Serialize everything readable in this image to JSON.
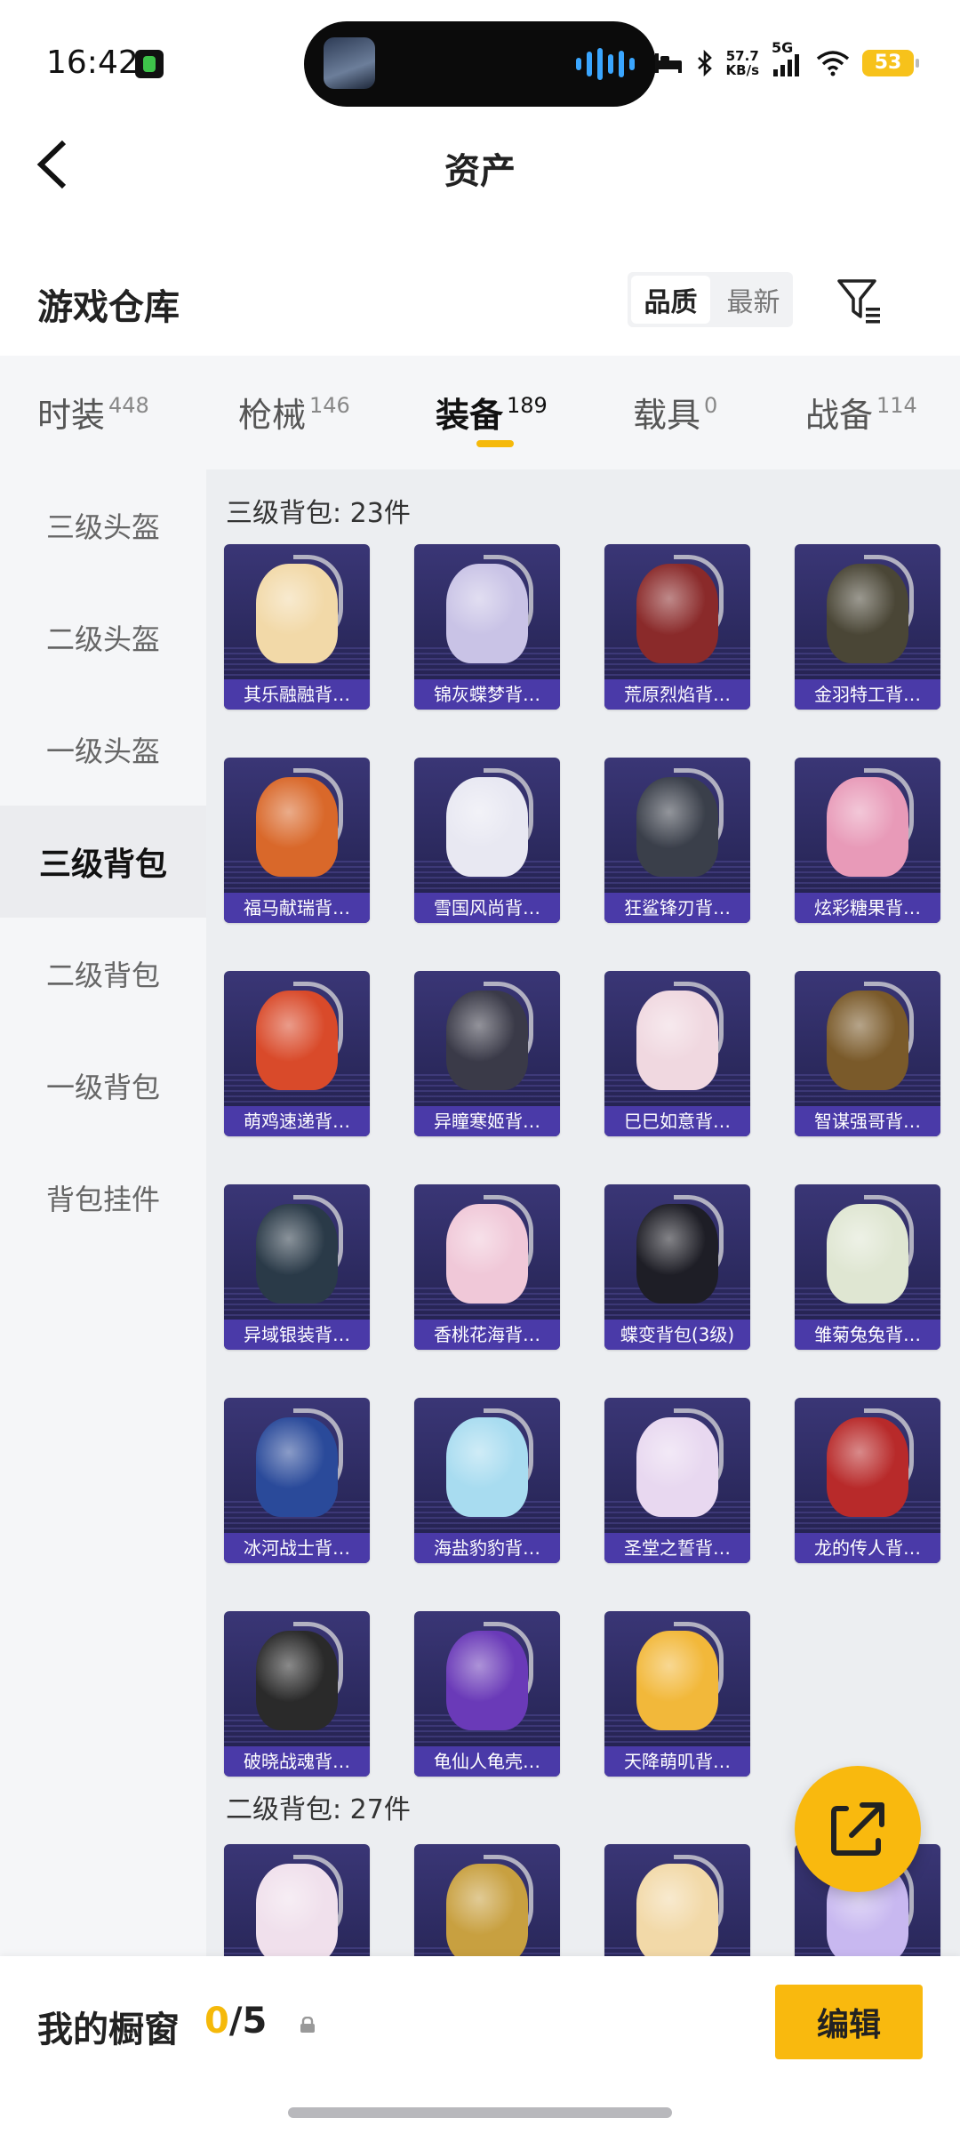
{
  "status_bar": {
    "time": "16:42",
    "speed_value": "57.7",
    "speed_unit": "KB/s",
    "network": "5G",
    "battery": "53",
    "icons": [
      "app-notification-icon",
      "bed-icon",
      "bluetooth-icon",
      "signal-icon",
      "wifi-icon",
      "battery-icon"
    ]
  },
  "header": {
    "title": "资产",
    "back_icon": "chevron-left-icon"
  },
  "warehouse": {
    "title": "游戏仓库",
    "sort_options": [
      "品质",
      "最新"
    ],
    "sort_active": "品质",
    "filter_icon": "filter-icon"
  },
  "tabs": [
    {
      "label": "时装",
      "count": "448"
    },
    {
      "label": "枪械",
      "count": "146"
    },
    {
      "label": "装备",
      "count": "189",
      "active": true
    },
    {
      "label": "载具",
      "count": "0"
    },
    {
      "label": "战备",
      "count": "114"
    }
  ],
  "side_menu": {
    "items": [
      "三级头盔",
      "二级头盔",
      "一级头盔",
      "三级背包",
      "二级背包",
      "一级背包",
      "背包挂件"
    ],
    "active": "三级背包"
  },
  "sections": [
    {
      "title": "三级背包: 23件",
      "items": [
        "其乐融融背…",
        "锦灰蝶梦背…",
        "荒原烈焰背…",
        "金羽特工背…",
        "福马献瑞背…",
        "雪国风尚背…",
        "狂鲨锋刃背…",
        "炫彩糖果背…",
        "萌鸡速递背…",
        "异瞳寒姬背…",
        "巳巳如意背…",
        "智谋强哥背…",
        "异域银装背…",
        "香桃花海背…",
        "蝶变背包(3级)",
        "雏菊兔兔背…",
        "冰河战士背…",
        "海盐豹豹背…",
        "圣堂之誓背…",
        "龙的传人背…",
        "破晓战魂背…",
        "龟仙人龟壳…",
        "天降萌叽背…"
      ]
    },
    {
      "title": "二级背包: 27件",
      "items": [
        "",
        "",
        "",
        ""
      ]
    }
  ],
  "item_colors": [
    "#f2d9a8",
    "#c9c3e6",
    "#8a2a2a",
    "#4a4636",
    "#d9682a",
    "#e8e8f2",
    "#3a3f4a",
    "#e89ab8",
    "#d94a2a",
    "#3a3a48",
    "#f0d8e0",
    "#7a5a2a",
    "#2a3a48",
    "#f0c8d8",
    "#1e1e26",
    "#dfe6d2",
    "#2a4a9a",
    "#a8dcf0",
    "#e8d8f0",
    "#b82a2a",
    "#2a2a2a",
    "#6a3ab8",
    "#f2b83a",
    "#f0e0ec",
    "#c8a040",
    "#f2d9a8",
    "#c8b8f0"
  ],
  "fab": {
    "icon": "share-icon"
  },
  "bottom": {
    "showcase_label": "我的橱窗",
    "used": "0",
    "separator": "/",
    "total": "5",
    "lock_icon": "lock-icon",
    "edit_label": "编辑"
  },
  "colors": {
    "accent": "#f9b90e",
    "label_bar": "#4a3aa8",
    "card_bg": "#2c2a5f"
  }
}
